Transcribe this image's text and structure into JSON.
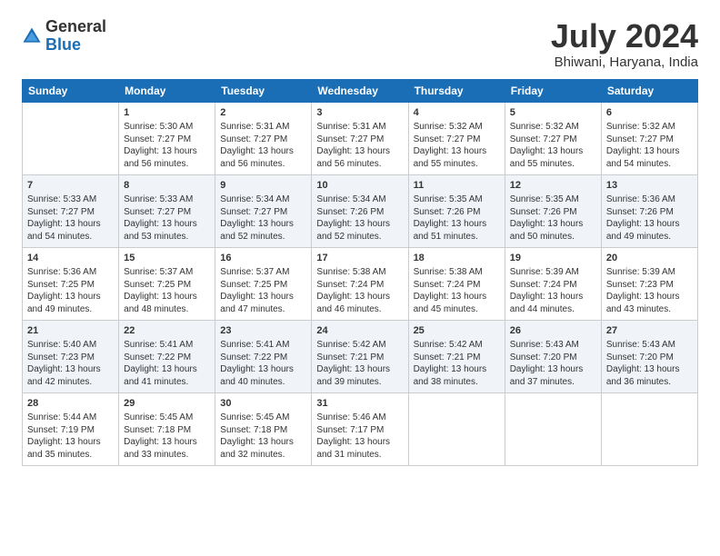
{
  "header": {
    "logo": {
      "line1": "General",
      "line2": "Blue"
    },
    "title": "July 2024",
    "subtitle": "Bhiwani, Haryana, India"
  },
  "days_of_week": [
    "Sunday",
    "Monday",
    "Tuesday",
    "Wednesday",
    "Thursday",
    "Friday",
    "Saturday"
  ],
  "weeks": [
    [
      {
        "day": "",
        "info": ""
      },
      {
        "day": "1",
        "info": "Sunrise: 5:30 AM\nSunset: 7:27 PM\nDaylight: 13 hours\nand 56 minutes."
      },
      {
        "day": "2",
        "info": "Sunrise: 5:31 AM\nSunset: 7:27 PM\nDaylight: 13 hours\nand 56 minutes."
      },
      {
        "day": "3",
        "info": "Sunrise: 5:31 AM\nSunset: 7:27 PM\nDaylight: 13 hours\nand 56 minutes."
      },
      {
        "day": "4",
        "info": "Sunrise: 5:32 AM\nSunset: 7:27 PM\nDaylight: 13 hours\nand 55 minutes."
      },
      {
        "day": "5",
        "info": "Sunrise: 5:32 AM\nSunset: 7:27 PM\nDaylight: 13 hours\nand 55 minutes."
      },
      {
        "day": "6",
        "info": "Sunrise: 5:32 AM\nSunset: 7:27 PM\nDaylight: 13 hours\nand 54 minutes."
      }
    ],
    [
      {
        "day": "7",
        "info": "Sunrise: 5:33 AM\nSunset: 7:27 PM\nDaylight: 13 hours\nand 54 minutes."
      },
      {
        "day": "8",
        "info": "Sunrise: 5:33 AM\nSunset: 7:27 PM\nDaylight: 13 hours\nand 53 minutes."
      },
      {
        "day": "9",
        "info": "Sunrise: 5:34 AM\nSunset: 7:27 PM\nDaylight: 13 hours\nand 52 minutes."
      },
      {
        "day": "10",
        "info": "Sunrise: 5:34 AM\nSunset: 7:26 PM\nDaylight: 13 hours\nand 52 minutes."
      },
      {
        "day": "11",
        "info": "Sunrise: 5:35 AM\nSunset: 7:26 PM\nDaylight: 13 hours\nand 51 minutes."
      },
      {
        "day": "12",
        "info": "Sunrise: 5:35 AM\nSunset: 7:26 PM\nDaylight: 13 hours\nand 50 minutes."
      },
      {
        "day": "13",
        "info": "Sunrise: 5:36 AM\nSunset: 7:26 PM\nDaylight: 13 hours\nand 49 minutes."
      }
    ],
    [
      {
        "day": "14",
        "info": "Sunrise: 5:36 AM\nSunset: 7:25 PM\nDaylight: 13 hours\nand 49 minutes."
      },
      {
        "day": "15",
        "info": "Sunrise: 5:37 AM\nSunset: 7:25 PM\nDaylight: 13 hours\nand 48 minutes."
      },
      {
        "day": "16",
        "info": "Sunrise: 5:37 AM\nSunset: 7:25 PM\nDaylight: 13 hours\nand 47 minutes."
      },
      {
        "day": "17",
        "info": "Sunrise: 5:38 AM\nSunset: 7:24 PM\nDaylight: 13 hours\nand 46 minutes."
      },
      {
        "day": "18",
        "info": "Sunrise: 5:38 AM\nSunset: 7:24 PM\nDaylight: 13 hours\nand 45 minutes."
      },
      {
        "day": "19",
        "info": "Sunrise: 5:39 AM\nSunset: 7:24 PM\nDaylight: 13 hours\nand 44 minutes."
      },
      {
        "day": "20",
        "info": "Sunrise: 5:39 AM\nSunset: 7:23 PM\nDaylight: 13 hours\nand 43 minutes."
      }
    ],
    [
      {
        "day": "21",
        "info": "Sunrise: 5:40 AM\nSunset: 7:23 PM\nDaylight: 13 hours\nand 42 minutes."
      },
      {
        "day": "22",
        "info": "Sunrise: 5:41 AM\nSunset: 7:22 PM\nDaylight: 13 hours\nand 41 minutes."
      },
      {
        "day": "23",
        "info": "Sunrise: 5:41 AM\nSunset: 7:22 PM\nDaylight: 13 hours\nand 40 minutes."
      },
      {
        "day": "24",
        "info": "Sunrise: 5:42 AM\nSunset: 7:21 PM\nDaylight: 13 hours\nand 39 minutes."
      },
      {
        "day": "25",
        "info": "Sunrise: 5:42 AM\nSunset: 7:21 PM\nDaylight: 13 hours\nand 38 minutes."
      },
      {
        "day": "26",
        "info": "Sunrise: 5:43 AM\nSunset: 7:20 PM\nDaylight: 13 hours\nand 37 minutes."
      },
      {
        "day": "27",
        "info": "Sunrise: 5:43 AM\nSunset: 7:20 PM\nDaylight: 13 hours\nand 36 minutes."
      }
    ],
    [
      {
        "day": "28",
        "info": "Sunrise: 5:44 AM\nSunset: 7:19 PM\nDaylight: 13 hours\nand 35 minutes."
      },
      {
        "day": "29",
        "info": "Sunrise: 5:45 AM\nSunset: 7:18 PM\nDaylight: 13 hours\nand 33 minutes."
      },
      {
        "day": "30",
        "info": "Sunrise: 5:45 AM\nSunset: 7:18 PM\nDaylight: 13 hours\nand 32 minutes."
      },
      {
        "day": "31",
        "info": "Sunrise: 5:46 AM\nSunset: 7:17 PM\nDaylight: 13 hours\nand 31 minutes."
      },
      {
        "day": "",
        "info": ""
      },
      {
        "day": "",
        "info": ""
      },
      {
        "day": "",
        "info": ""
      }
    ]
  ]
}
